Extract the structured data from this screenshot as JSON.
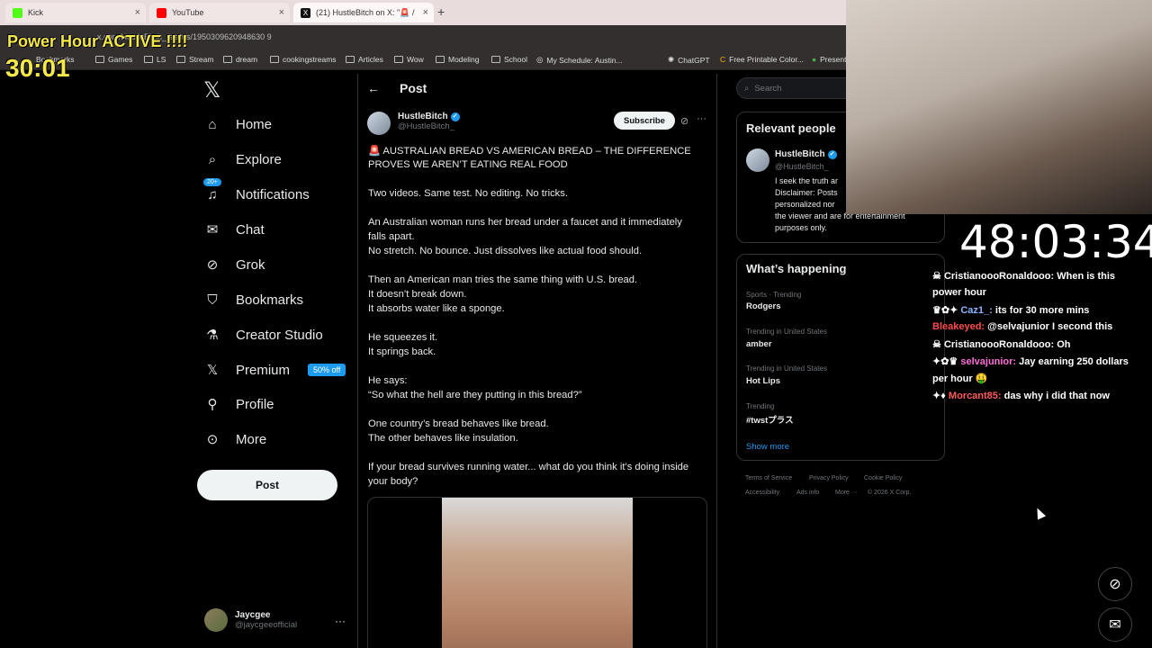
{
  "browser": {
    "tabs": [
      {
        "label": "Kick",
        "color": "#53fc18"
      },
      {
        "label": "YouTube",
        "color": "#ff0000"
      },
      {
        "label": "(21) HustleBitch on X: \"🚨 /",
        "color": "#111111"
      }
    ],
    "url": "x.com/HustleBitch_/status/1950309620948630 9",
    "bookmarks": [
      "Bookmarks",
      "Games",
      "LS",
      "Stream",
      "dream",
      "cookingstreams",
      "Articles",
      "Wow",
      "Modeling",
      "School",
      "My Schedule: Austin...",
      "ChatGPT",
      "Free Printable Color...",
      "Present"
    ]
  },
  "overlay": {
    "power_hour": "Power Hour ACTIVE !!!!",
    "power_timer": "30:01",
    "big_timer": "48:03:34"
  },
  "nav": {
    "items": [
      {
        "label": "Home",
        "icon": "home-icon"
      },
      {
        "label": "Explore",
        "icon": "search-icon"
      },
      {
        "label": "Notifications",
        "icon": "bell-icon",
        "badge": "20+"
      },
      {
        "label": "Chat",
        "icon": "mail-icon"
      },
      {
        "label": "Grok",
        "icon": "grok-icon"
      },
      {
        "label": "Bookmarks",
        "icon": "bookmark-icon"
      },
      {
        "label": "Creator Studio",
        "icon": "flask-icon"
      },
      {
        "label": "Premium",
        "icon": "x-icon",
        "badge": "50% off"
      },
      {
        "label": "Profile",
        "icon": "person-icon"
      },
      {
        "label": "More",
        "icon": "more-icon"
      }
    ],
    "post_button": "Post",
    "account": {
      "name": "Jaycgee",
      "handle": "@jaycgeeofficial"
    }
  },
  "post": {
    "header": "Post",
    "author_name": "HustleBitch",
    "author_handle": "@HustleBitch_",
    "subscribe": "Subscribe",
    "lines": [
      "🚨 AUSTRALIAN BREAD VS AMERICAN BREAD – THE DIFFERENCE",
      "PROVES WE AREN’T EATING REAL FOOD",
      "Two videos. Same test. No editing. No tricks.",
      "An Australian woman runs her bread under a faucet and it immediately",
      "falls apart.",
      "No stretch. No bounce. Just dissolves like actual food should.",
      "Then an American man tries the same thing with U.S. bread.",
      "It doesn’t break down.",
      "It absorbs water like a sponge.",
      "He squeezes it.",
      "It springs back.",
      "He says:",
      "“So what the hell are they putting in this bread?”",
      "One country’s bread behaves like bread.",
      "The other behaves like insulation.",
      "If your bread survives running water... what do you think it’s doing inside",
      "your body?"
    ]
  },
  "sidebar": {
    "search_placeholder": "Search",
    "relevant_title": "Relevant people",
    "relevant": {
      "name": "HustleBitch",
      "handle": "@HustleBitch_",
      "bio": [
        "I seek the truth ar",
        "Disclaimer: Posts",
        "personalized nor",
        "the viewer and are for entertainment",
        "purposes only."
      ]
    },
    "happening_title": "What’s happening",
    "trends": [
      {
        "category": "Sports · Trending",
        "name": "Rodgers"
      },
      {
        "category": "Trending in United States",
        "name": "amber"
      },
      {
        "category": "Trending in United States",
        "name": "Hot Lips"
      },
      {
        "category": "Trending",
        "name": "#twstプラス"
      }
    ],
    "show_more": "Show more",
    "footer": [
      "Terms of Service",
      "Privacy Policy",
      "Cookie Policy",
      "Accessibility",
      "Ads info",
      "More ···",
      "© 2026 X Corp."
    ]
  },
  "chat": [
    {
      "user": "CristianoooRonaldooo:",
      "msg": "When is this",
      "color": "#ffffff"
    },
    {
      "user": "",
      "msg": "power hour",
      "color": "#ffffff"
    },
    {
      "user": "Caz1_:",
      "msg": "its for 30 more mins",
      "color": "#8ab4ff"
    },
    {
      "user": "Bleakeyed:",
      "msg": "@selvajunior I second this",
      "color": "#ff4b4b"
    },
    {
      "user": "CristianoooRonaldooo:",
      "msg": "Oh",
      "color": "#ffffff"
    },
    {
      "user": "selvajunior:",
      "msg": "Jay earning 250 dollars",
      "color": "#ff6fd8"
    },
    {
      "user": "",
      "msg": "per hour 🤑",
      "color": "#ffffff"
    },
    {
      "user": "Morcant85:",
      "msg": "das why i did that now",
      "color": "#ff5a5a"
    }
  ]
}
